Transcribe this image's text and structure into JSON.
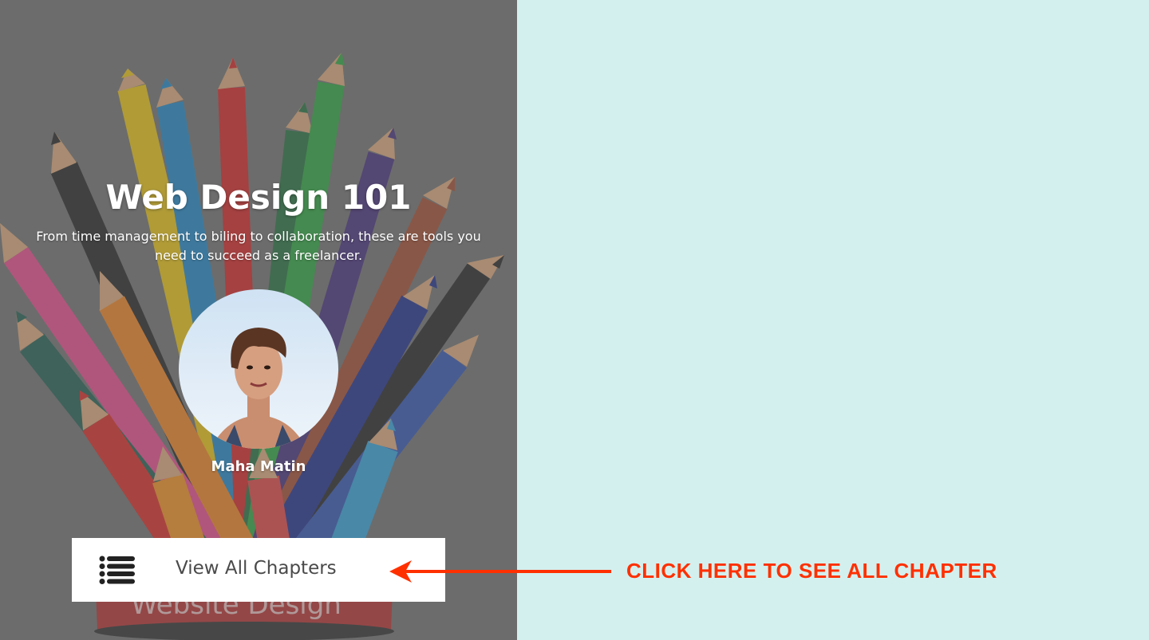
{
  "course": {
    "title": "Web Design 101",
    "subtitle": "From time management to biling to collaboration, these are tools you need to succeed as a freelancer.",
    "author": "Maha Matin",
    "cover_caption": "Website Design"
  },
  "actions": {
    "view_chapters_label": "View All Chapters",
    "view_chapters_icon": "list-icon"
  },
  "annotation": {
    "callout_text": "CLICK HERE TO SEE ALL CHAPTER",
    "color": "#ff3000"
  },
  "colors": {
    "panel_background": "#d3f0ef",
    "cover_overlay": "#6c6c6c"
  }
}
